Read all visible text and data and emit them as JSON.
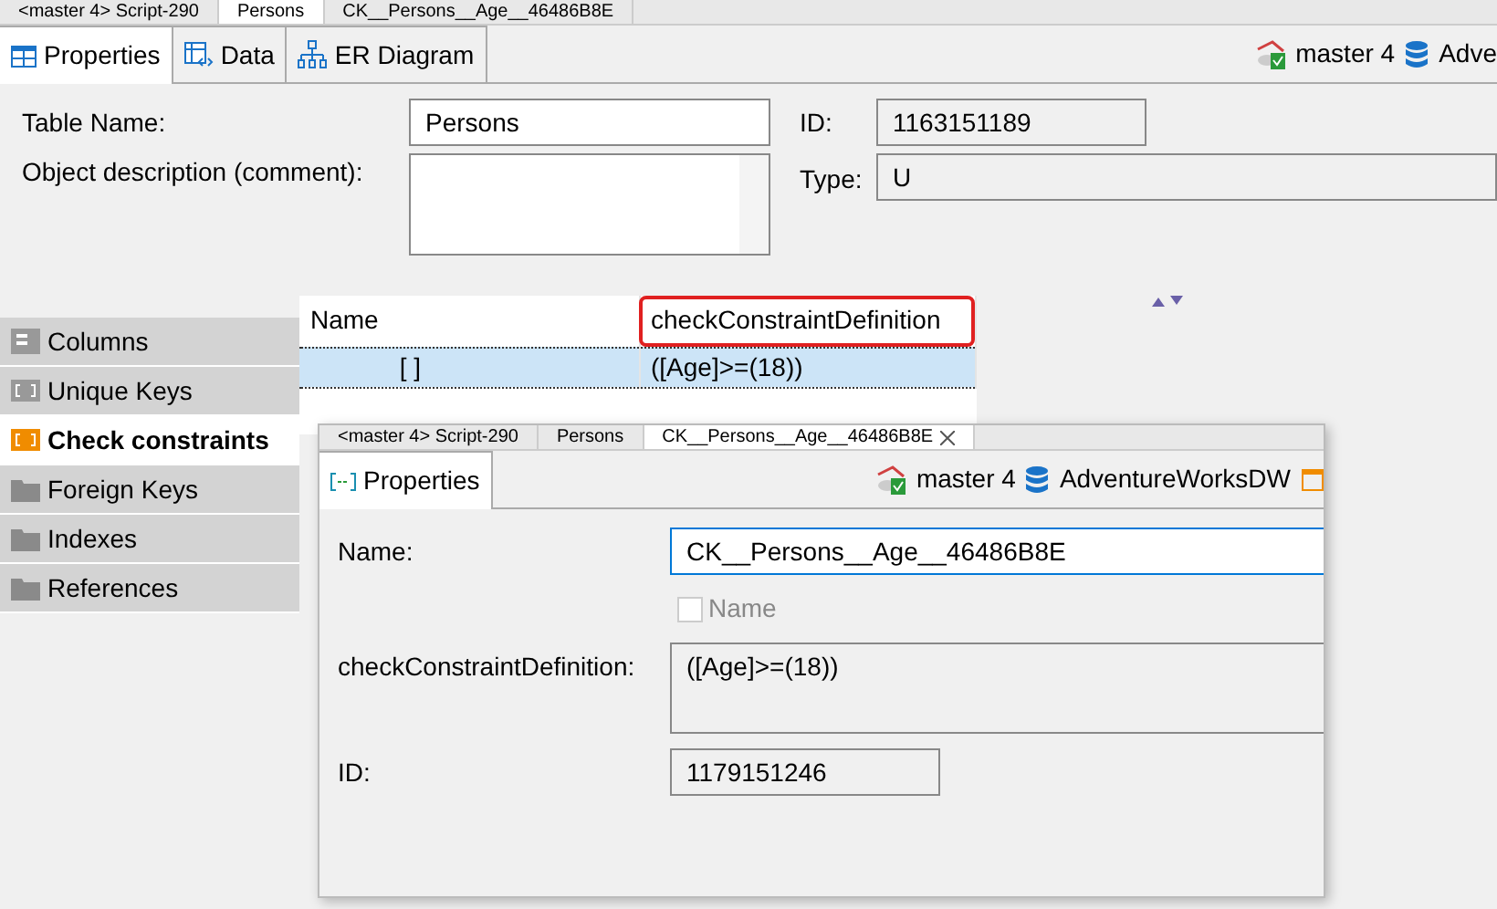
{
  "editor_tabs": [
    {
      "label": "<master 4> Script-290",
      "selected": false
    },
    {
      "label": "Persons",
      "selected": true
    },
    {
      "label": "CK__Persons__Age__46486B8E",
      "selected": false
    }
  ],
  "view_tabs": [
    {
      "label": "Properties",
      "kind": "table",
      "selected": true
    },
    {
      "label": "Data",
      "kind": "data",
      "selected": false
    },
    {
      "label": "ER Diagram",
      "kind": "diagram",
      "selected": false
    }
  ],
  "connection": {
    "branch": "master 4",
    "database": "Adve"
  },
  "form": {
    "table_name_label": "Table Name:",
    "table_name": "Persons",
    "description_label": "Object description (comment):",
    "id_label": "ID:",
    "id": "1163151189",
    "type_label": "Type:",
    "type": "U"
  },
  "sections": [
    {
      "label": "Columns",
      "kind": "list",
      "selected": false
    },
    {
      "label": "Unique Keys",
      "kind": "bracket",
      "selected": false
    },
    {
      "label": "Check constraints",
      "kind": "bracket",
      "selected": true
    },
    {
      "label": "Foreign Keys",
      "kind": "folder",
      "selected": false
    },
    {
      "label": "Indexes",
      "kind": "folder",
      "selected": false
    },
    {
      "label": "References",
      "kind": "folder",
      "selected": false
    }
  ],
  "table": {
    "columns": [
      {
        "label": "Name",
        "highlighted": false
      },
      {
        "label": "checkConstraintDefinition",
        "highlighted": true
      }
    ],
    "rows": [
      {
        "cells": [
          "[ ]",
          "([Age]>=(18))"
        ],
        "selected": true
      }
    ]
  },
  "popup": {
    "editor_tabs": [
      {
        "label": "<master 4> Script-290",
        "selected": false
      },
      {
        "label": "Persons",
        "selected": false
      },
      {
        "label": "CK__Persons__Age__46486B8E",
        "selected": true
      }
    ],
    "view_tabs": [
      {
        "label": "Properties",
        "kind": "constraint",
        "selected": true
      }
    ],
    "connection": {
      "branch": "master 4",
      "database": "AdventureWorksDW"
    },
    "fields": [
      {
        "kind": "text",
        "label": "Name:",
        "value": "CK__Persons__Age__46486B8E",
        "focused": true
      },
      {
        "kind": "checkbox",
        "label": "Name",
        "checked": false,
        "disabled": true
      },
      {
        "kind": "textarea",
        "label": "checkConstraintDefinition:",
        "value": "([Age]>=(18))"
      },
      {
        "kind": "text",
        "label": "ID:",
        "value": "1179151246",
        "focused": false
      }
    ]
  }
}
